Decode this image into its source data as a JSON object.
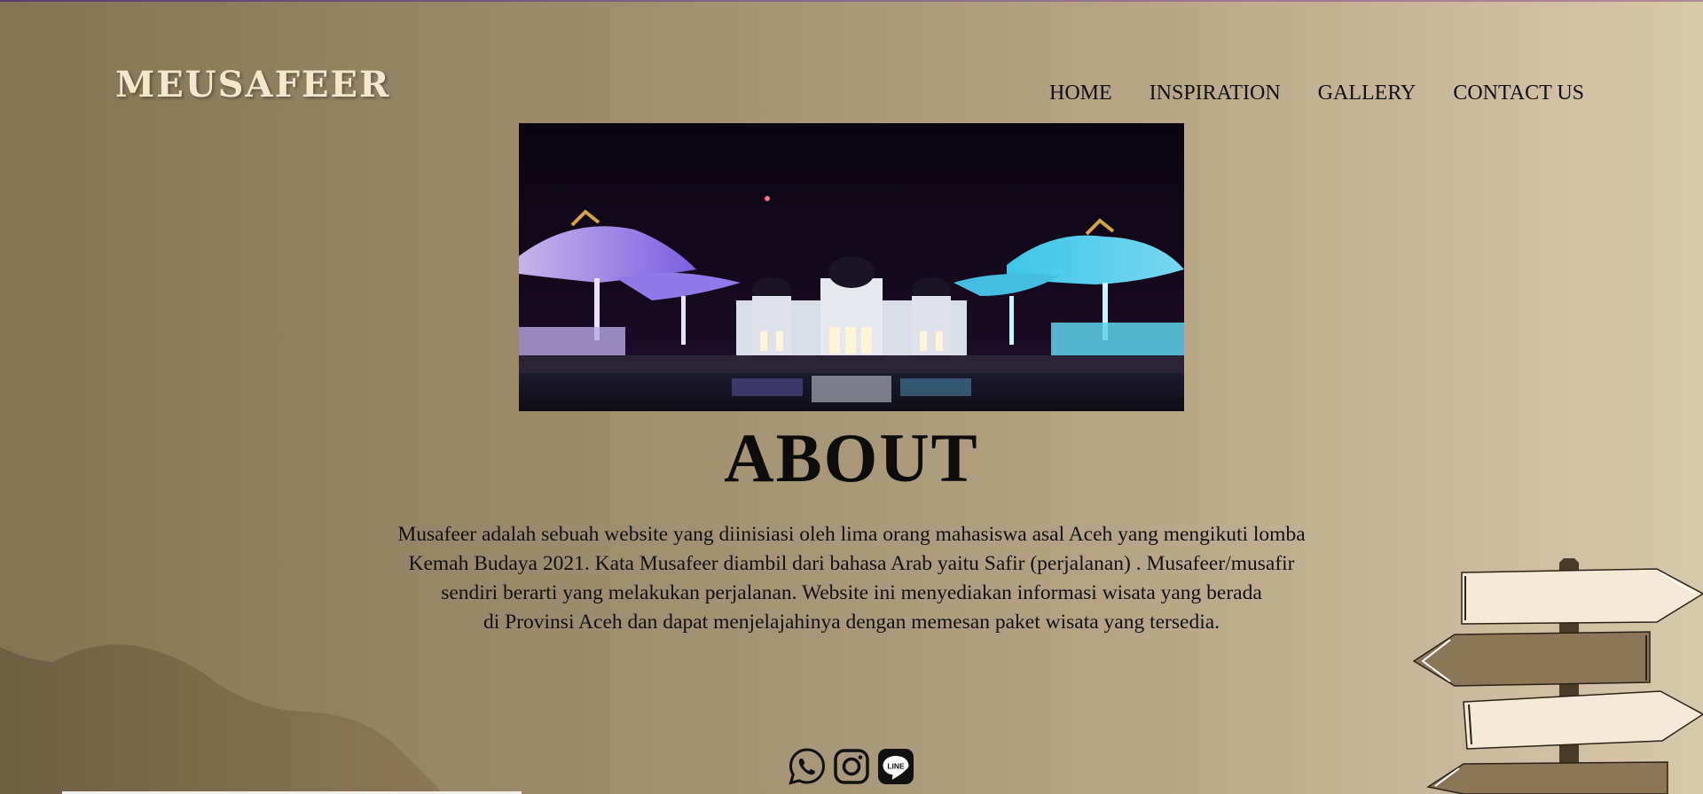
{
  "brand": {
    "name": "MEUSAFEER"
  },
  "nav": {
    "items": [
      {
        "label": "HOME"
      },
      {
        "label": "INSPIRATION"
      },
      {
        "label": "GALLERY"
      },
      {
        "label": "CONTACT US"
      }
    ]
  },
  "about": {
    "title": "ABOUT",
    "paragraph_lines": [
      "Musafeer adalah sebuah website yang diinisiasi oleh lima orang mahasiswa asal Aceh yang mengikuti lomba",
      "Kemah Budaya 2021. Kata Musafeer diambil dari bahasa Arab yaitu Safir (perjalanan) . Musafeer/musafir",
      "sendiri berarti yang melakukan perjalanan. Website ini menyediakan informasi wisata yang berada",
      "di Provinsi Aceh dan dapat menjelajahinya dengan memesan paket wisata yang tersedia."
    ]
  },
  "social": {
    "icons": [
      "whatsapp-icon",
      "instagram-icon",
      "line-icon"
    ],
    "line_label": "LINE"
  },
  "colors": {
    "brand_text": "#f6e6cc",
    "background_dark": "#857354",
    "background_light": "#d8c8ac",
    "sign_cream": "#f5ead6",
    "sign_brown": "#8b7758"
  }
}
